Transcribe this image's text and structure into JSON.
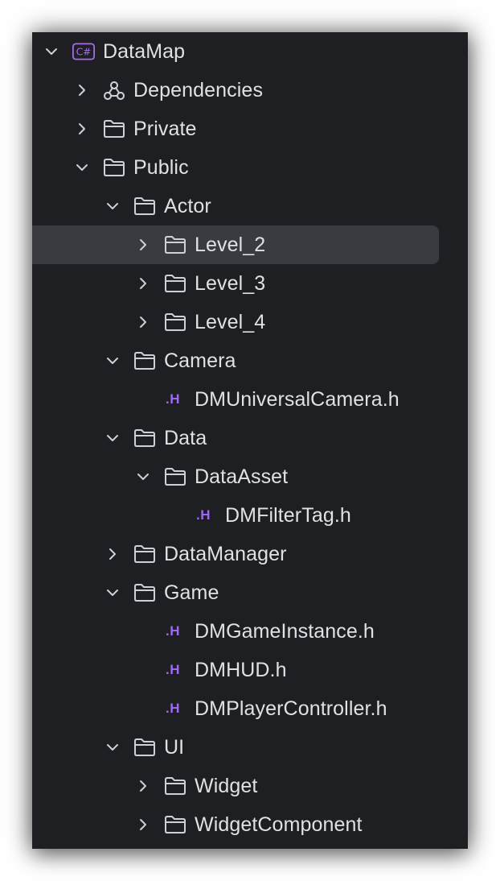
{
  "tree": {
    "items": [
      {
        "label": "DataMap",
        "depth": 0,
        "kind": "project",
        "expanded": true,
        "icon": "csharp-project-icon"
      },
      {
        "label": "Dependencies",
        "depth": 1,
        "kind": "deps",
        "expanded": false,
        "icon": "dependencies-icon"
      },
      {
        "label": "Private",
        "depth": 1,
        "kind": "folder",
        "expanded": false,
        "icon": "folder-icon"
      },
      {
        "label": "Public",
        "depth": 1,
        "kind": "folder",
        "expanded": true,
        "icon": "folder-icon"
      },
      {
        "label": "Actor",
        "depth": 2,
        "kind": "folder",
        "expanded": true,
        "icon": "folder-icon"
      },
      {
        "label": "Level_2",
        "depth": 3,
        "kind": "folder",
        "expanded": false,
        "icon": "folder-icon",
        "selected": true
      },
      {
        "label": "Level_3",
        "depth": 3,
        "kind": "folder",
        "expanded": false,
        "icon": "folder-icon"
      },
      {
        "label": "Level_4",
        "depth": 3,
        "kind": "folder",
        "expanded": false,
        "icon": "folder-icon"
      },
      {
        "label": "Camera",
        "depth": 2,
        "kind": "folder",
        "expanded": true,
        "icon": "folder-icon"
      },
      {
        "label": "DMUniversalCamera.h",
        "depth": 3,
        "kind": "header",
        "icon": "header-file-icon"
      },
      {
        "label": "Data",
        "depth": 2,
        "kind": "folder",
        "expanded": true,
        "icon": "folder-icon"
      },
      {
        "label": "DataAsset",
        "depth": 3,
        "kind": "folder",
        "expanded": true,
        "icon": "folder-icon"
      },
      {
        "label": "DMFilterTag.h",
        "depth": 4,
        "kind": "header",
        "icon": "header-file-icon"
      },
      {
        "label": "DataManager",
        "depth": 2,
        "kind": "folder",
        "expanded": false,
        "icon": "folder-icon"
      },
      {
        "label": "Game",
        "depth": 2,
        "kind": "folder",
        "expanded": true,
        "icon": "folder-icon"
      },
      {
        "label": "DMGameInstance.h",
        "depth": 3,
        "kind": "header",
        "icon": "header-file-icon"
      },
      {
        "label": "DMHUD.h",
        "depth": 3,
        "kind": "header",
        "icon": "header-file-icon"
      },
      {
        "label": "DMPlayerController.h",
        "depth": 3,
        "kind": "header",
        "icon": "header-file-icon"
      },
      {
        "label": "UI",
        "depth": 2,
        "kind": "folder",
        "expanded": true,
        "icon": "folder-icon"
      },
      {
        "label": "Widget",
        "depth": 3,
        "kind": "folder",
        "expanded": false,
        "icon": "folder-icon"
      },
      {
        "label": "WidgetComponent",
        "depth": 3,
        "kind": "folder",
        "expanded": false,
        "icon": "folder-icon"
      }
    ],
    "header_icon_text": ".H",
    "project_icon_text": "C#"
  },
  "colors": {
    "background": "#1e1f22",
    "selection": "#393b40",
    "text": "#dfe1e5",
    "icon_stroke": "#ced0d6",
    "header_icon": "#9b6cf2",
    "project_icon": "#a66ee8"
  }
}
